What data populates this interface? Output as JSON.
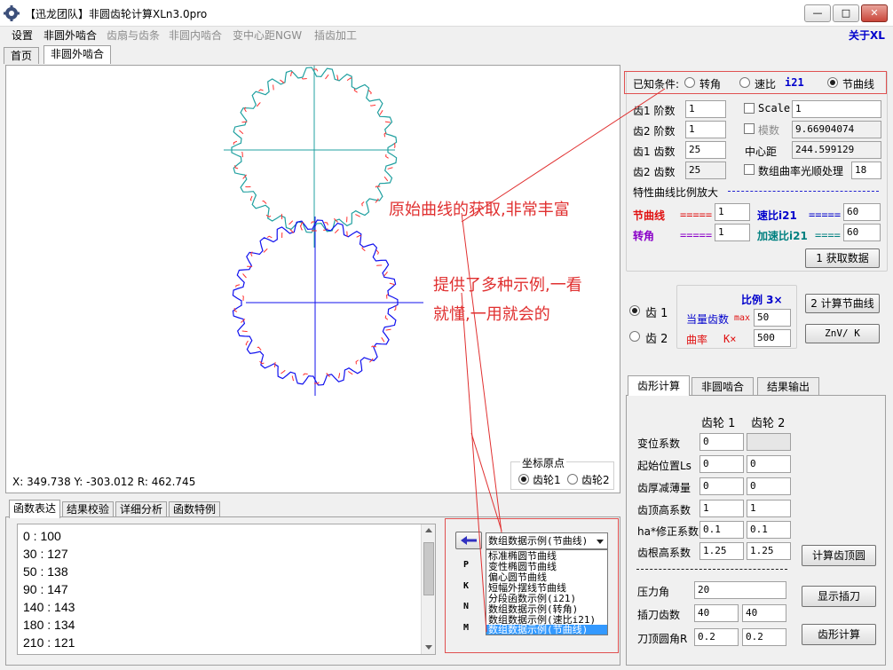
{
  "window": {
    "title": "【迅龙团队】非圆齿轮计算XLn3.0pro",
    "minimize": "—",
    "maximize": "□",
    "close": "✕"
  },
  "menu": {
    "items": [
      {
        "label": "设置",
        "enabled": true
      },
      {
        "label": "非圆外啮合",
        "enabled": true
      },
      {
        "label": "齿扇与齿条",
        "enabled": false
      },
      {
        "label": "非圆内啮合",
        "enabled": false
      },
      {
        "label": "变中心距NGW",
        "enabled": false
      },
      {
        "label": "插齿加工",
        "enabled": false
      }
    ],
    "about": "关于XL"
  },
  "tabs": {
    "home": "首页",
    "external": "非圆外啮合"
  },
  "canvas": {
    "status": "X: 349.738  Y: -303.012  R: 462.745",
    "origin_group": "坐标原点",
    "origin_gear1": "齿轮1",
    "origin_gear2": "齿轮2",
    "gear1_color": "#ff3030",
    "gear1_teeth_color": "#20a0a0",
    "gear2_color": "#1010ee",
    "gear1_teeth": 25,
    "gear2_teeth": 25
  },
  "annotations": {
    "a1": "原始曲线的获取,非常丰富",
    "a2": "提供了多种示例,一看",
    "a3": "就懂,一用就会的"
  },
  "conditions": {
    "label": "已知条件:",
    "opt_angle": "转角",
    "opt_ratio": "速比",
    "opt_ratio_code": "i21",
    "opt_pitch": "节曲线",
    "selected": "节曲线"
  },
  "params": {
    "g1_order_label": "齿1 阶数",
    "g1_order": "1",
    "g2_order_label": "齿2 阶数",
    "g2_order": "1",
    "g1_teeth_label": "齿1 齿数",
    "g1_teeth": "25",
    "g2_teeth_label": "齿2 齿数",
    "g2_teeth": "25",
    "scale_label": "Scale",
    "scale": "1",
    "module_label": "模数",
    "module": "9.66904074",
    "center_label": "中心距",
    "center": "244.599129",
    "smooth_label": "数组曲率光顺处理",
    "smooth": "18",
    "magnify_title": "特性曲线比例放大",
    "pitch_label": "节曲线",
    "pitch_eq": "=====",
    "pitch_val": "1",
    "angle_label": "转角",
    "angle_eq": "=====",
    "angle_val": "1",
    "ratio_label": "速比i21",
    "ratio_eq": "=====",
    "ratio_val": "60",
    "accel_label": "加速比i21",
    "accel_eq": "====",
    "accel_val": "60",
    "get_data_btn": "1 获取数据"
  },
  "ratio_panel": {
    "gear1": "齿 1",
    "gear2": "齿 2",
    "title": "比例 3×",
    "eq_teeth_label": "当量齿数",
    "eq_teeth_sub": "max",
    "eq_teeth": "50",
    "curv_label": "曲率",
    "curv_sub": "K×",
    "curv": "500",
    "calc_pitch_btn": "2 计算节曲线",
    "znv_btn": "ZnV/ K"
  },
  "bottom_tabs": {
    "t1": "齿形计算",
    "t2": "非圆啮合",
    "t3": "结果输出"
  },
  "tooth": {
    "head1": "齿轮 1",
    "head2": "齿轮 2",
    "rows": [
      {
        "label": "变位系数",
        "v1": "0",
        "v2": ""
      },
      {
        "label": "起始位置Ls",
        "v1": "0",
        "v2": "0"
      },
      {
        "label": "齿厚减薄量",
        "v1": "0",
        "v2": "0"
      },
      {
        "label": "齿顶高系数",
        "v1": "1",
        "v2": "1"
      },
      {
        "label": "ha*修正系数",
        "v1": "0.1",
        "v2": "0.1"
      },
      {
        "label": "齿根高系数",
        "v1": "1.25",
        "v2": "1.25"
      }
    ],
    "pressure_label": "压力角",
    "pressure": "20",
    "cutter_teeth_label": "插刀齿数",
    "cutter_teeth1": "40",
    "cutter_teeth2": "40",
    "tip_radius_label": "刀顶圆角R",
    "tip_radius1": "0.2",
    "tip_radius2": "0.2",
    "btn_tip": "计算齿顶圆",
    "btn_cutter": "显示插刀",
    "btn_tooth": "齿形计算"
  },
  "func_tabs": {
    "t1": "函数表达",
    "t2": "结果校验",
    "t3": "详细分析",
    "t4": "函数特例"
  },
  "func_list": [
    "0 : 100",
    "30 : 127",
    "50 : 138",
    "90 : 147",
    "140 : 143",
    "180 : 134",
    "210 : 121"
  ],
  "examples": {
    "side_letters": [
      "P",
      "K",
      "N",
      "M"
    ],
    "selected": "数组数据示例(节曲线)",
    "options": [
      "标准椭圆节曲线",
      "变性椭圆节曲线",
      "偏心圆节曲线",
      "短幅外摆线节曲线",
      "分段函数示例(i21)",
      "数组数据示例(转角)",
      "数组数据示例(速比i21)",
      "数组数据示例(节曲线)"
    ]
  }
}
